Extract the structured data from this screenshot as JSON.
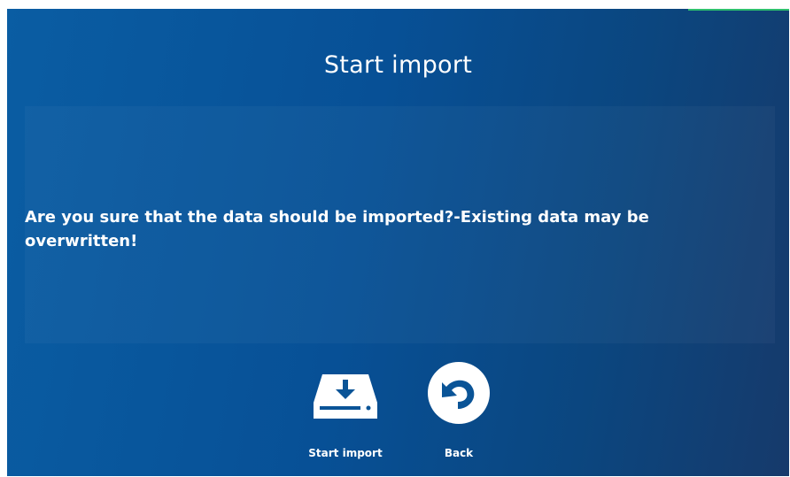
{
  "dialog": {
    "title": "Start import",
    "message": "Are you sure that the data should be imported?-Existing data may be overwritten!"
  },
  "actions": {
    "start_import": {
      "label": "Start import",
      "icon": "download-drive-icon"
    },
    "back": {
      "label": "Back",
      "icon": "back-arrow-icon"
    }
  },
  "colors": {
    "background_start": "#0a5da3",
    "background_end": "#163a6b",
    "text": "#ffffff",
    "accent": "#2fbf6e"
  }
}
